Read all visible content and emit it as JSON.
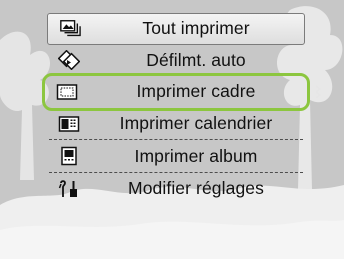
{
  "menu": {
    "items": [
      {
        "label": "Tout imprimer",
        "icon": "print-all-icon"
      },
      {
        "label": "Défilmt. auto",
        "icon": "slideshow-icon"
      },
      {
        "label": "Imprimer cadre",
        "icon": "frame-print-icon"
      },
      {
        "label": "Imprimer calendrier",
        "icon": "calendar-print-icon"
      },
      {
        "label": "Imprimer album",
        "icon": "album-print-icon"
      },
      {
        "label": "Modifier réglages",
        "icon": "settings-icon"
      }
    ],
    "selected_index": 2
  },
  "colors": {
    "background": "#c9c9c9",
    "highlight": "#8cc63f",
    "first_item_bg": "#e9e9e9"
  }
}
